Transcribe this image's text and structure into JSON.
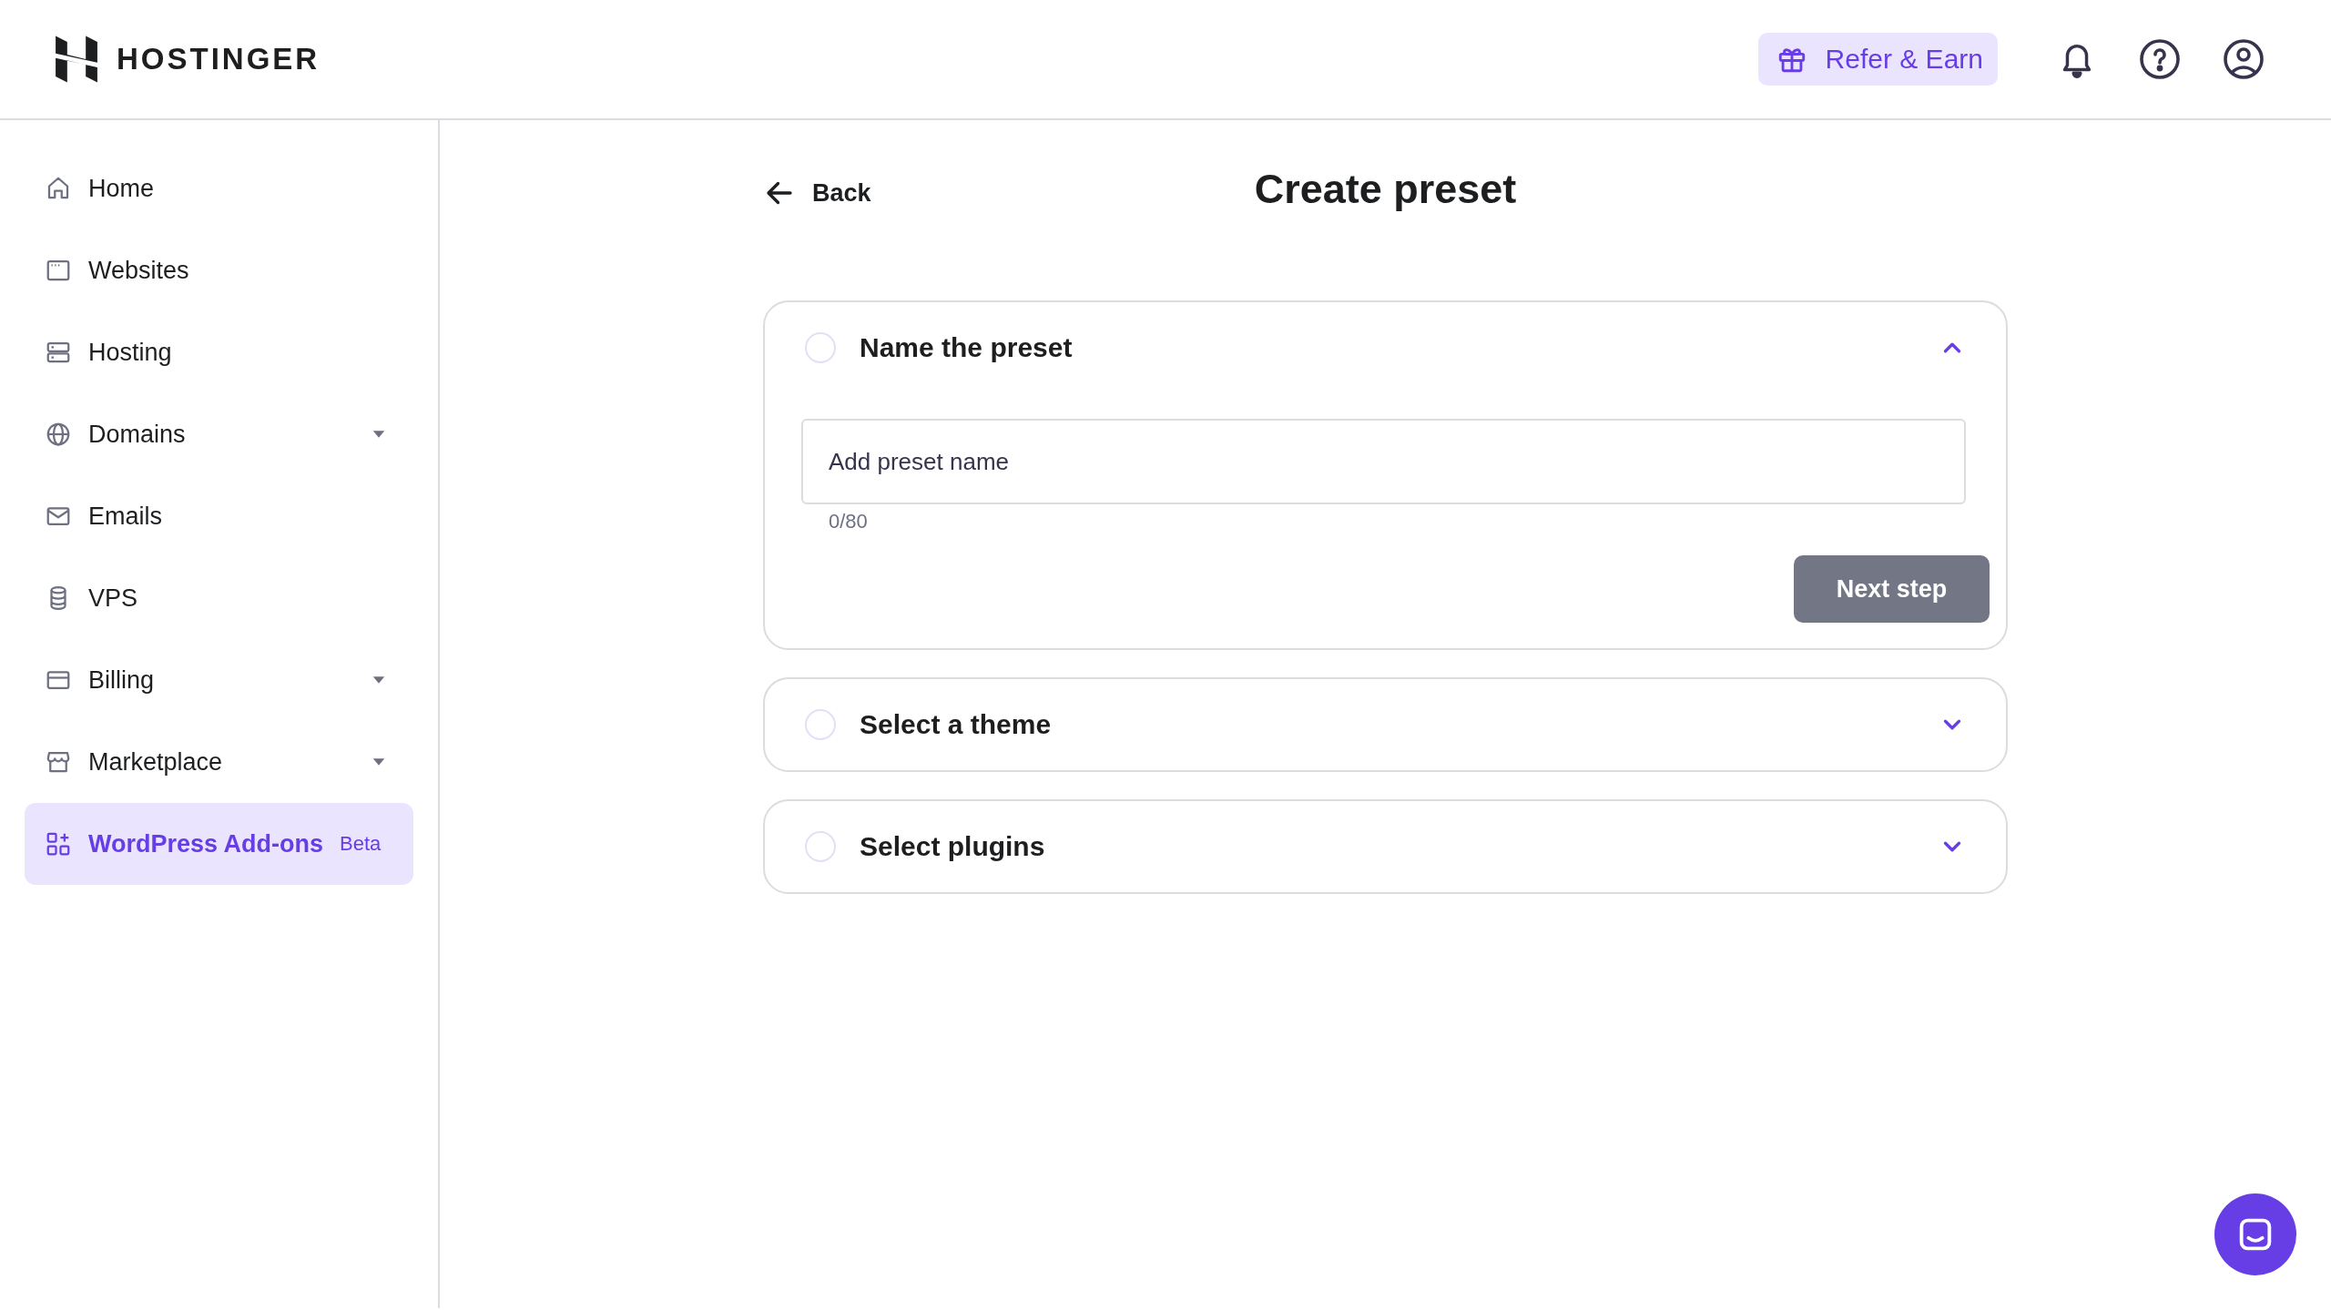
{
  "header": {
    "logo_text": "HOSTINGER",
    "refer_button": "Refer & Earn"
  },
  "sidebar": {
    "items": [
      {
        "label": "Home",
        "has_submenu": false,
        "selected": false
      },
      {
        "label": "Websites",
        "has_submenu": false,
        "selected": false
      },
      {
        "label": "Hosting",
        "has_submenu": false,
        "selected": false
      },
      {
        "label": "Domains",
        "has_submenu": true,
        "selected": false
      },
      {
        "label": "Emails",
        "has_submenu": false,
        "selected": false
      },
      {
        "label": "VPS",
        "has_submenu": false,
        "selected": false
      },
      {
        "label": "Billing",
        "has_submenu": true,
        "selected": false
      },
      {
        "label": "Marketplace",
        "has_submenu": true,
        "selected": false
      },
      {
        "label": "WordPress Add-ons",
        "has_submenu": false,
        "selected": true,
        "badge": "Beta"
      }
    ]
  },
  "page": {
    "back": "Back",
    "title": "Create preset",
    "steps": [
      {
        "title": "Name the preset",
        "expanded": true,
        "field": {
          "placeholder": "Add preset name",
          "counter": "0/80"
        },
        "button": "Next step"
      },
      {
        "title": "Select a theme",
        "expanded": false
      },
      {
        "title": "Select plugins",
        "expanded": false
      }
    ]
  }
}
